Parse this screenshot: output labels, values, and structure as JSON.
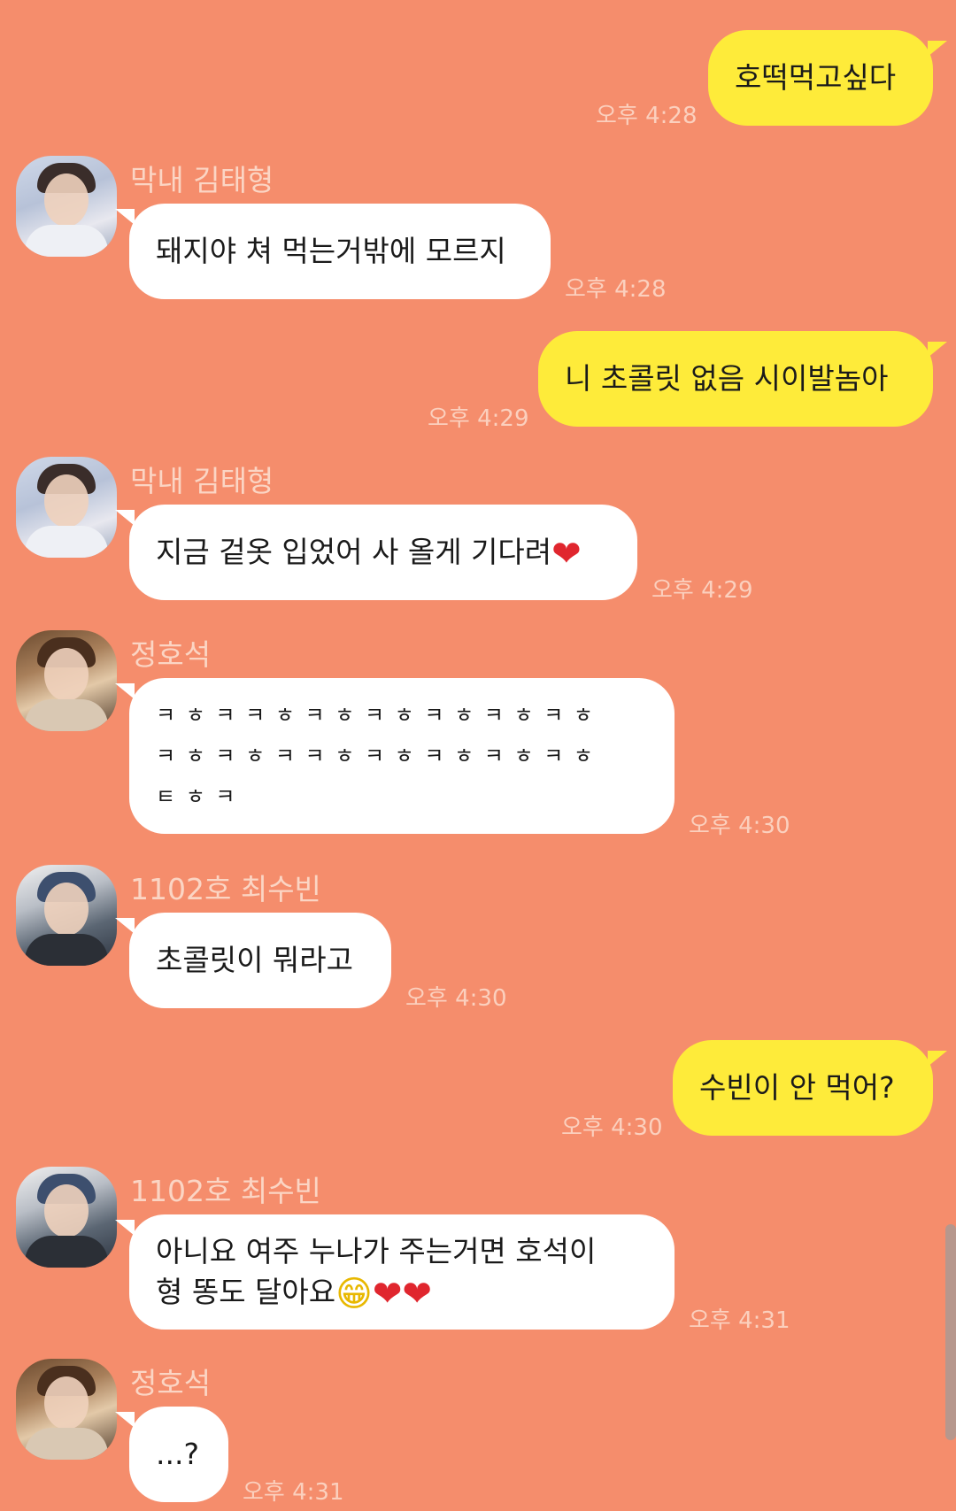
{
  "messages": [
    {
      "type": "out",
      "text": "호떡먹고싶다",
      "time": "오후 4:28"
    },
    {
      "type": "in",
      "sender": "막내 김태형",
      "avatar": "avatar-kim-taehyung",
      "text": "돼지야 쳐 먹는거밖에 모르지",
      "time": "오후 4:28"
    },
    {
      "type": "out",
      "text": "니 초콜릿 없음 시이발놈아",
      "time": "오후 4:29"
    },
    {
      "type": "in",
      "sender": "막내 김태형",
      "avatar": "avatar-kim-taehyung",
      "text": "지금 겉옷 입었어 사 올게 기다려",
      "emoji": "red-heart",
      "time": "오후 4:29"
    },
    {
      "type": "in",
      "sender": "정호석",
      "avatar": "avatar-jung-hoseok",
      "lines": [
        "ㅋ ㅎ ㅋ ㅋ ㅎ ㅋ ㅎ ㅋ ㅎ ㅋ ㅎ ㅋ ㅎ ㅋ ㅎ",
        "ㅋ ㅎ ㅋ ㅎ ㅋ ㅋ ㅎ ㅋ ㅎ ㅋ ㅎ ㅋ ㅎ ㅋ ㅎ",
        "ㅌ ㅎ ㅋ"
      ],
      "time": "오후 4:30"
    },
    {
      "type": "in",
      "sender": "1102호 최수빈",
      "avatar": "avatar-choi-soobin",
      "text": "초콜릿이 뭐라고",
      "time": "오후 4:30"
    },
    {
      "type": "out",
      "text": "수빈이 안 먹어?",
      "time": "오후 4:30"
    },
    {
      "type": "in",
      "sender": "1102호 최수빈",
      "avatar": "avatar-choi-soobin",
      "lines": [
        "아니요 여주 누나가 주는거면 호석이",
        "형 똥도 달아요"
      ],
      "emoji": "grin-red-heart-red-heart",
      "time": "오후 4:31"
    },
    {
      "type": "in",
      "sender": "정호석",
      "avatar": "avatar-jung-hoseok",
      "text": "...?",
      "time": "오후 4:31"
    }
  ],
  "icons": {
    "heart": "❤",
    "grin": "😁"
  },
  "colors": {
    "background": "#F58D6C",
    "bubble_out": "#FEEB3A",
    "bubble_in": "#FFFFFF",
    "timestamp": "#FBD0BE",
    "sender_name": "#FBD5C4"
  }
}
